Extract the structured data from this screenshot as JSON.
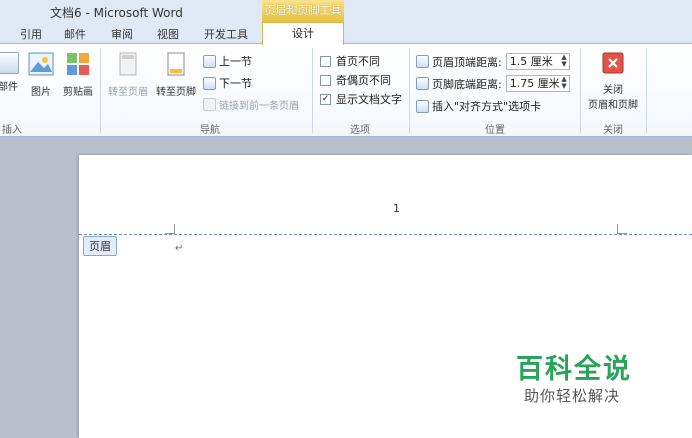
{
  "window": {
    "title": "文档6 - Microsoft Word",
    "context_tab_title": "页眉和页脚工具"
  },
  "tabs": [
    {
      "label": "引用"
    },
    {
      "label": "邮件"
    },
    {
      "label": "审阅"
    },
    {
      "label": "视图"
    },
    {
      "label": "开发工具"
    }
  ],
  "active_tab": {
    "label": "设计"
  },
  "ribbon": {
    "insert_group": {
      "label": "插入",
      "buttons": [
        {
          "label": "部件"
        },
        {
          "label": "图片"
        },
        {
          "label": "剪贴画"
        }
      ]
    },
    "nav_group": {
      "label": "导航",
      "goto_header": "转至页眉",
      "goto_footer": "转至页脚",
      "prev_section": "上一节",
      "next_section": "下一节",
      "link_previous": "链接到前一条页眉"
    },
    "options_group": {
      "label": "选项",
      "first_page_diff": {
        "label": "首页不同",
        "checked": false
      },
      "odd_even_diff": {
        "label": "奇偶页不同",
        "checked": false
      },
      "show_doc_text": {
        "label": "显示文档文字",
        "checked": true
      }
    },
    "position_group": {
      "label": "位置",
      "header_top_label": "页眉顶端距离:",
      "header_top_value": "1.5 厘米",
      "footer_bottom_label": "页脚底端距离:",
      "footer_bottom_value": "1.75 厘米",
      "insert_align_tab": "插入\"对齐方式\"选项卡"
    },
    "close_group": {
      "label": "关闭",
      "close_button_line1": "关闭",
      "close_button_line2": "页眉和页脚"
    }
  },
  "document": {
    "header_tag": "页眉",
    "page_number_glyph": "1",
    "return_mark": "↵"
  },
  "watermark": {
    "title": "百科全说",
    "subtitle": "助你轻松解决"
  },
  "colors": {
    "accent_gold": "#e8c23e",
    "watermark_green": "#29a35a",
    "header_dash": "#6a90c8"
  }
}
